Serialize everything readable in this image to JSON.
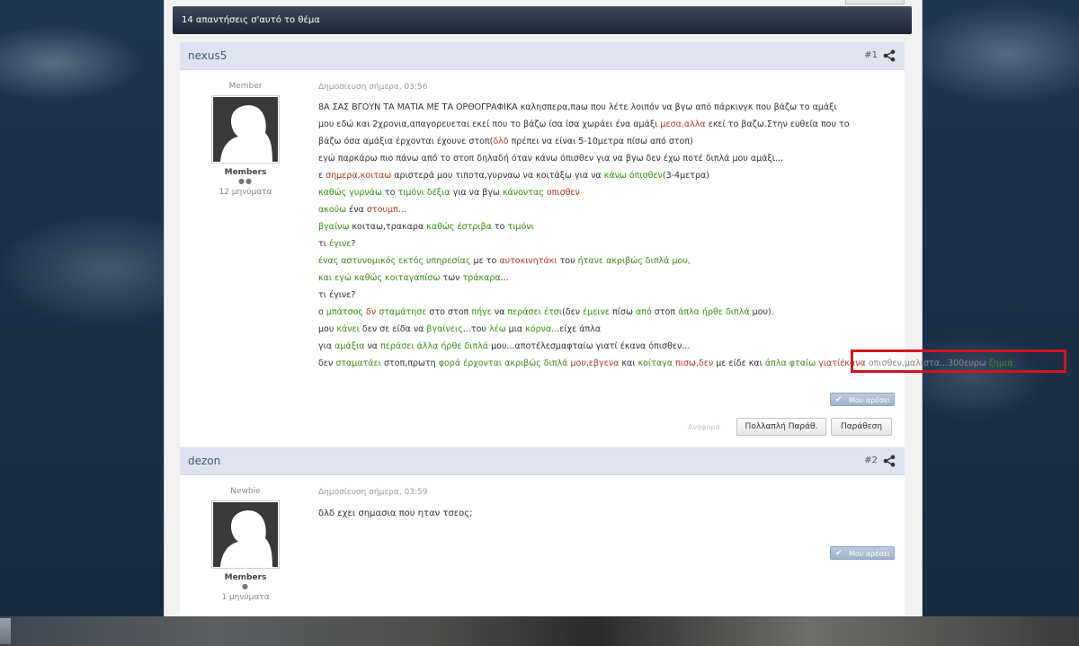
{
  "topic": {
    "header": "14 απαντήσεις σ'αυτό το θέμα"
  },
  "posts": [
    {
      "author": "nexus5",
      "number": "#1",
      "rank": "Member",
      "group": "Members",
      "pips": "●●",
      "post_count": "12 μηνύματα",
      "date": "Δημοσίευση σήμερα, 03:56",
      "like_label": "Μου αρέσει",
      "report_label": "Αναφορά",
      "multiquote_label": "Πολλαπλή Παράθ.",
      "quote_label": "Παράθεση",
      "lines": [
        [
          {
            "t": "8Α ΣΑΣ ΒΓΟΥΝ ΤΑ ΜΑΤΙΑ ΜΕ ΤΑ ΟΡΘΟΓΡΑΦΙΚΑ καλησπερα,πaω που λέτε λοιπόν να βγω από πάρκινγκ που βάζω το αμάξι",
            "c": ""
          }
        ],
        [
          {
            "t": "μου εδώ και 2χρονια,απαγορευεται εκεί που το βάζω ίσα ίσα χωράει ένα αμάξι ",
            "c": ""
          },
          {
            "t": "μεσα,αλλα",
            "c": "r"
          },
          {
            "t": " εκεί το βαζω.Στην ευθεία που το",
            "c": ""
          }
        ],
        [
          {
            "t": "βάζω όσα αμάξια έρχονται έχουνε στοπ(",
            "c": ""
          },
          {
            "t": "δλδ",
            "c": "r"
          },
          {
            "t": " πρέπει να είναι 5-10μετρα πίσω από στοπ)",
            "c": ""
          }
        ],
        [
          {
            "t": "εγώ παρκάρω πιο πάνω από το στοπ δηλαδή όταν κάνω όπισθεν για να βγω δεν έχω ποτέ διπλά μου αμάξι...",
            "c": ""
          }
        ],
        [
          {
            "t": "ε ",
            "c": ""
          },
          {
            "t": "σημερα,κοιταω",
            "c": "r"
          },
          {
            "t": " αριστερά μου τιποτα,γυρναω να κοιτάξω για να ",
            "c": ""
          },
          {
            "t": "κάνω όπισθεν",
            "c": "g"
          },
          {
            "t": "(3-4μετρα)",
            "c": ""
          }
        ],
        [
          {
            "t": "καθώς γυρνάω",
            "c": "g"
          },
          {
            "t": " το ",
            "c": ""
          },
          {
            "t": "τιμόνι δέξια",
            "c": "g"
          },
          {
            "t": " για να βγω ",
            "c": ""
          },
          {
            "t": "κάνοντας",
            "c": "g"
          },
          {
            "t": " ",
            "c": ""
          },
          {
            "t": "οπισθεν",
            "c": "r"
          }
        ],
        [
          {
            "t": "ακούω ",
            "c": "g"
          },
          {
            "t": "ένα ",
            "c": ""
          },
          {
            "t": "στουμπ",
            "c": "r"
          },
          {
            "t": "...",
            "c": ""
          }
        ],
        [
          {
            "t": "βγαίνω",
            "c": "g"
          },
          {
            "t": " κοιταω,τρακαρα ",
            "c": ""
          },
          {
            "t": "καθώς έστριβα",
            "c": "g"
          },
          {
            "t": " το ",
            "c": ""
          },
          {
            "t": "τιμόνι",
            "c": "g"
          }
        ],
        [
          {
            "t": "τι ",
            "c": ""
          },
          {
            "t": "έγινε",
            "c": "g"
          },
          {
            "t": "?",
            "c": ""
          }
        ],
        [
          {
            "t": "ένας αστυνομικός εκτός υπηρεσίας",
            "c": "g"
          },
          {
            "t": " με το ",
            "c": ""
          },
          {
            "t": "αυτοκινητάκι",
            "c": "r"
          },
          {
            "t": " του ",
            "c": ""
          },
          {
            "t": "ήτανε ακριβώς διπλά μου,",
            "c": "g"
          }
        ],
        [
          {
            "t": "και εγώ καθώς κοιταγαπίσω",
            "c": "g"
          },
          {
            "t": " των ",
            "c": ""
          },
          {
            "t": "τράκαρα",
            "c": "g"
          },
          {
            "t": "...",
            "c": ""
          }
        ],
        [
          {
            "t": "τι έγινε?",
            "c": ""
          }
        ],
        [
          {
            "t": "ο ",
            "c": ""
          },
          {
            "t": "μπάτσος",
            "c": "g"
          },
          {
            "t": " ",
            "c": ""
          },
          {
            "t": "δν",
            "c": "r"
          },
          {
            "t": " ",
            "c": ""
          },
          {
            "t": "σταμάτησε",
            "c": "g"
          },
          {
            "t": " στο στοπ ",
            "c": ""
          },
          {
            "t": "πήγε",
            "c": "g"
          },
          {
            "t": " να ",
            "c": ""
          },
          {
            "t": "περάσει έτσι",
            "c": "g"
          },
          {
            "t": "(δεν ",
            "c": ""
          },
          {
            "t": "έμεινε",
            "c": "g"
          },
          {
            "t": " πίσω ",
            "c": ""
          },
          {
            "t": "από",
            "c": "g"
          },
          {
            "t": " στοπ ",
            "c": ""
          },
          {
            "t": "άπλα ήρθε διπλά",
            "c": "g"
          },
          {
            "t": " μου).",
            "c": ""
          }
        ],
        [
          {
            "t": "μου ",
            "c": ""
          },
          {
            "t": "κάνει",
            "c": "g"
          },
          {
            "t": " δεν σε είδα να ",
            "c": ""
          },
          {
            "t": "βγαίνεις",
            "c": "g"
          },
          {
            "t": "...του ",
            "c": ""
          },
          {
            "t": "λέω",
            "c": "g"
          },
          {
            "t": " μια ",
            "c": ""
          },
          {
            "t": "κόρνα",
            "c": "g"
          },
          {
            "t": "...είχε άπλα",
            "c": ""
          }
        ],
        [
          {
            "t": "για ",
            "c": ""
          },
          {
            "t": "αμάξια",
            "c": "g"
          },
          {
            "t": " να ",
            "c": ""
          },
          {
            "t": "περάσει άλλα ήρθε διπλά",
            "c": "g"
          },
          {
            "t": " μου...αποτέλεσμαφταίω γιατί έκανα όπισθεν...",
            "c": ""
          }
        ],
        [
          {
            "t": "δεν ",
            "c": ""
          },
          {
            "t": "σταματάει",
            "c": "g"
          },
          {
            "t": " στοπ,πρωτη ",
            "c": ""
          },
          {
            "t": "φορά έρχονται ακριβώς διπλά",
            "c": "g"
          },
          {
            "t": " ",
            "c": ""
          },
          {
            "t": "μου,εβγενα",
            "c": "r"
          },
          {
            "t": " και ",
            "c": ""
          },
          {
            "t": "κοίταγα",
            "c": "g"
          },
          {
            "t": " ",
            "c": ""
          },
          {
            "t": "πισω,δεν",
            "c": "r"
          },
          {
            "t": " με είδε και ",
            "c": ""
          },
          {
            "t": "άπλα φταίω",
            "c": "g"
          },
          {
            "t": " ",
            "c": ""
          },
          {
            "t": "γιατίέκανα",
            "c": "r"
          },
          {
            "t": " ",
            "c": ""
          },
          {
            "t": "οπισθεν,μαλιστα...300ευρω",
            "c": "d"
          },
          {
            "t": " ",
            "c": ""
          },
          {
            "t": "ζημιά",
            "c": "g"
          }
        ]
      ]
    },
    {
      "author": "dezon",
      "number": "#2",
      "rank": "Newbie",
      "group": "Members",
      "pips": "●",
      "post_count": "1 μηνύματα",
      "date": "Δημοσίευση σήμερα, 03:59",
      "like_label": "Μου αρέσει",
      "lines": [
        [
          {
            "t": "δλδ εχει σημασια που ηταν τσεος;",
            "c": ""
          }
        ]
      ]
    }
  ],
  "icons": {
    "share": "share-icon",
    "like": "check-icon",
    "avatar": "default-avatar-silhouette"
  }
}
